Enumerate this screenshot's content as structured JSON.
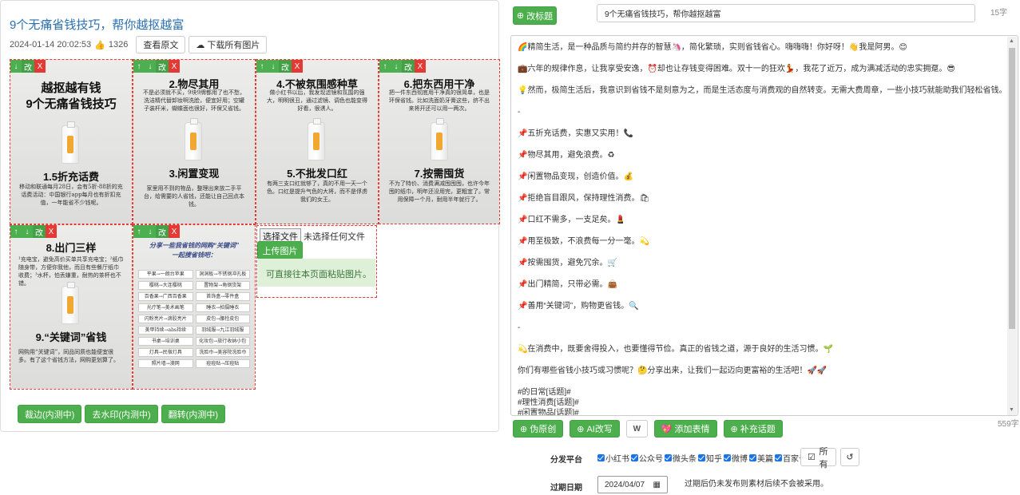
{
  "article": {
    "title": "9个无痛省钱技巧，帮你越抠越富",
    "datetime": "2024-01-14 20:02:53",
    "likes": "1326",
    "view_original": "查看原文",
    "download_all": "下载所有图片"
  },
  "tile_controls": {
    "down": "↓",
    "up": "↑",
    "edit": "改",
    "delete": "X"
  },
  "tiles": [
    {
      "h1": "越抠越有钱",
      "h1b": "9个无痛省钱技巧",
      "h2": "1.5折充话费",
      "body": "移动和联通每月28日，会有5折-88折的充话费活动：中国银行app每月也有折扣充值，一年能省不少钱呢。"
    },
    {
      "h1": "2.物尽其用",
      "top": "不是必须就不买，9块9牌都用了也不愁，洗洁精代替卸妆啊洗脸，便宜好用；空罐子装杆米，蝴蝶面也很好，环保又省钱。",
      "h2": "3.闲置变现",
      "body": "家里用不到的物品，整理出来放二手平台，给需要的人省钱，还能让自己回点本钱。"
    },
    {
      "h1": "4.不被氛围感种草",
      "top": "做小红书以后，我发现滤镜和氛围的强大，明明很丑，通过滤镜、调色也能变得好看，很诱人。",
      "h2": "5.不批发口红",
      "body": "有两三支口红就够了，真的不用一天一个色。口红是提升气色的大将，而不是俘虏我们的女王。"
    },
    {
      "h1": "6.把东西用干净",
      "top": "把一件东西彻底用干净真的很简单，也是环保省钱。比如洗面奶牙膏这些，挤不出来将开还可以用一两次。",
      "h2": "7.按需囤货",
      "body": "不为了特价、消费满减囤囤囤，也许今年囤的纸巾，明年还没用完，更粗宜了。常用保障一个月，耐用半年就行了。"
    },
    {
      "h1": "8.出门三样",
      "top": "¹充电宝，避免高价买单共享充电宝；²纸巾随身带，方便你我他，而且有些餐厅纸巾收费；³水杯，怕丢嫌重，耐热的茶杯也不错。",
      "h2": "9.“关键词”省钱",
      "body": "网购用“关键词”，同品同质也能便宜很多。有了这个省钱方法，网购更划算了。"
    },
    {
      "h1": "分享一些我省钱的网购“关键词”",
      "h1b": "一起搜省钱吧：",
      "keywords": [
        [
          "平果→一朗台苹果",
          "洞洞板→不锈钢冲孔板"
        ],
        [
          "樱桃→大连樱桃",
          "置物架→角钢货架"
        ],
        [
          "百香果→广西百香果",
          "首饰盒→零件盒"
        ],
        [
          "光疗笔→美术画笔",
          "睡衣→拍摄睡衣"
        ],
        [
          "闪粉亮片→滴胶亮片",
          "皮包→腰栓皮包"
        ],
        [
          "美甲持续→abs持续",
          "羽绒服→九江羽绒服"
        ],
        [
          "书桌→培训桌",
          "化妆包→旅行收纳小包"
        ],
        [
          "灯具→民宿灯具",
          "洗脸巾→美容院洗脸巾"
        ],
        [
          "照片墙→澳网",
          "痘痘贴→压痘贴"
        ]
      ]
    }
  ],
  "upload": {
    "choose_file": "选择文件",
    "no_file": "未选择任何文件",
    "upload_btn": "上传图片",
    "paste_hint": "可直接往本页面粘贴图片。"
  },
  "image_tools": [
    "裁边(内测中)",
    "去水印(内测中)",
    "翻转(内测中)"
  ],
  "editor": {
    "rename_btn": "改标题",
    "title_value": "9个无痛省钱技巧，帮你越抠越富",
    "title_count": "15字",
    "body_lines": [
      "🌈精简生活，是一种品质与简约并存的智慧🦄，简化繁琐，实则省钱省心。嗨嗨嗨！你好呀！👋我是阿男。😊",
      "💼六年的规律作息，让我享受安逸，⏰却也让存钱变得困难。双十一的狂欢💃，我花了近万，成为满减活动的忠实拥趸。😎",
      "💡然而，极简生活后，我意识到省钱不是刻意为之，而是生活态度与消费观的自然转变。无需大费周章，一些小技巧就能助我们轻松省钱。💰",
      "-",
      "📌五折充话费，实惠又实用！📞",
      "📌物尽其用，避免浪费。♻",
      "📌闲置物品变现，创造价值。💰",
      "📌拒绝盲目跟风，保持理性消费。🛍",
      "📌口红不需多，一支足矣。💄",
      "📌用至极致，不浪费每一分一毫。💫",
      "📌按需囤货，避免冗余。🛒",
      "📌出门精简，只带必需。👜",
      "📌善用“关键词”，购物更省钱。🔍",
      "-",
      "💫在消费中，既要舍得投入，也要懂得节俭。真正的省钱之道，源于良好的生活习惯。🌱",
      "你们有哪些省钱小技巧或习惯呢？🤔分享出来，让我们一起迈向更富裕的生活吧！🚀🚀",
      "#的日常[话题]#",
      "#理性消费[话题]#",
      "#闲置物品[话题]#"
    ],
    "body_count": "559字"
  },
  "actions": {
    "pseudo_original": "伪原创",
    "ai_rewrite": "AI改写",
    "wp": "W",
    "add_emoji": "添加表情",
    "add_topic": "补充话题"
  },
  "platforms": {
    "label": "分发平台",
    "items": [
      "小红书",
      "公众号",
      "微头条",
      "知乎",
      "微博",
      "美篇",
      "百家号"
    ],
    "all_label": "所有"
  },
  "expiry": {
    "label": "过期日期",
    "date": "2024/04/07",
    "note": "过期后仍未发布则素材后续不会被采用。"
  },
  "colors": {
    "accent_green": "#4cae4c",
    "danger_red": "#e53935",
    "title_blue": "#2a6fb0"
  }
}
